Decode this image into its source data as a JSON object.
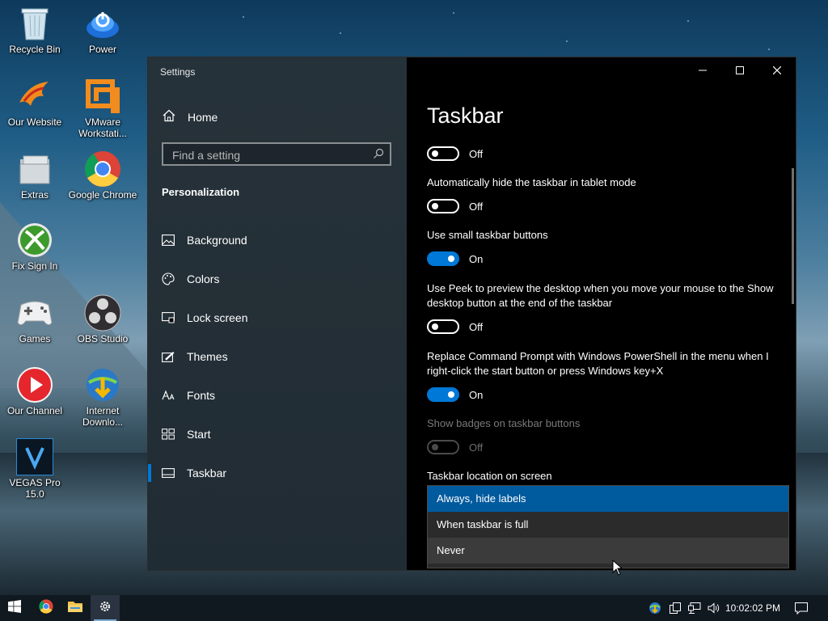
{
  "desktop": {
    "icons": [
      {
        "label": "Recycle Bin"
      },
      {
        "label": "Power"
      },
      {
        "label": "Our Website"
      },
      {
        "label": "VMware Workstati..."
      },
      {
        "label": "Extras"
      },
      {
        "label": "Google Chrome"
      },
      {
        "label": "Fix Sign In"
      },
      {
        "label": "Games"
      },
      {
        "label": "OBS Studio"
      },
      {
        "label": "Our Channel"
      },
      {
        "label": "Internet Downlo..."
      },
      {
        "label": "VEGAS Pro 15.0"
      }
    ]
  },
  "window": {
    "title": "Settings",
    "controls": {
      "minimize": "minimize-icon",
      "maximize": "maximize-icon",
      "close": "close-icon"
    }
  },
  "sidebar": {
    "home_label": "Home",
    "search_placeholder": "Find a setting",
    "section_title": "Personalization",
    "items": [
      {
        "label": "Background",
        "icon": "image-icon"
      },
      {
        "label": "Colors",
        "icon": "palette-icon"
      },
      {
        "label": "Lock screen",
        "icon": "lock-screen-icon"
      },
      {
        "label": "Themes",
        "icon": "themes-icon"
      },
      {
        "label": "Fonts",
        "icon": "fonts-icon"
      },
      {
        "label": "Start",
        "icon": "start-icon"
      },
      {
        "label": "Taskbar",
        "icon": "taskbar-icon",
        "active": true
      }
    ]
  },
  "main": {
    "title": "Taskbar",
    "settings": [
      {
        "label": "",
        "state": "Off"
      },
      {
        "label": "Automatically hide the taskbar in tablet mode",
        "state": "Off"
      },
      {
        "label": "Use small taskbar buttons",
        "state": "On"
      },
      {
        "label": "Use Peek to preview the desktop when you move your mouse to the Show desktop button at the end of the taskbar",
        "state": "Off"
      },
      {
        "label": "Replace Command Prompt with Windows PowerShell in the menu when I right-click the start button or press Windows key+X",
        "state": "On"
      },
      {
        "label": "Show badges on taskbar buttons",
        "state": "Off",
        "disabled": true
      }
    ],
    "location_label": "Taskbar location on screen",
    "dropdown_options": [
      {
        "label": "Always, hide labels",
        "selected": true
      },
      {
        "label": "When taskbar is full"
      },
      {
        "label": "Never",
        "hover": true
      }
    ]
  },
  "taskbar": {
    "clock": "10:02:02 PM",
    "accent": "#0078d7"
  }
}
